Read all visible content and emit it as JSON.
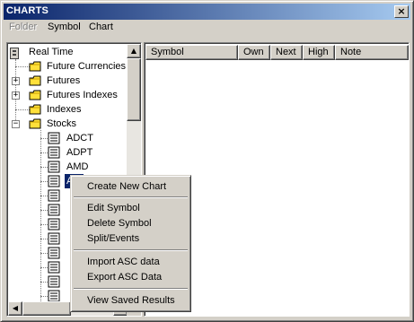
{
  "window": {
    "title": "CHARTS"
  },
  "menu": [
    {
      "label": "Folder",
      "enabled": false
    },
    {
      "label": "Symbol",
      "enabled": true
    },
    {
      "label": "Chart",
      "enabled": true
    }
  ],
  "tree": {
    "root": "Real Time",
    "folders": [
      {
        "label": "Future Currencies",
        "expander": ""
      },
      {
        "label": "Futures",
        "expander": "+"
      },
      {
        "label": "Futures Indexes",
        "expander": "+"
      },
      {
        "label": "Indexes",
        "expander": ""
      },
      {
        "label": "Stocks",
        "expander": "−"
      }
    ],
    "stocks": [
      "ADCT",
      "ADPT",
      "AMD",
      "AM"
    ]
  },
  "list": {
    "columns": [
      "Symbol",
      "Own",
      "Next",
      "High",
      "Note"
    ]
  },
  "context_menu": {
    "groups": [
      [
        "Create New Chart"
      ],
      [
        "Edit Symbol",
        "Delete Symbol",
        "Split/Events"
      ],
      [
        "Import ASC data",
        "Export ASC Data"
      ],
      [
        "View Saved Results"
      ]
    ]
  },
  "colors": {
    "titlebar_start": "#0a246a",
    "titlebar_end": "#a6caf0",
    "face": "#d4d0c8",
    "selection": "#0a246a"
  }
}
